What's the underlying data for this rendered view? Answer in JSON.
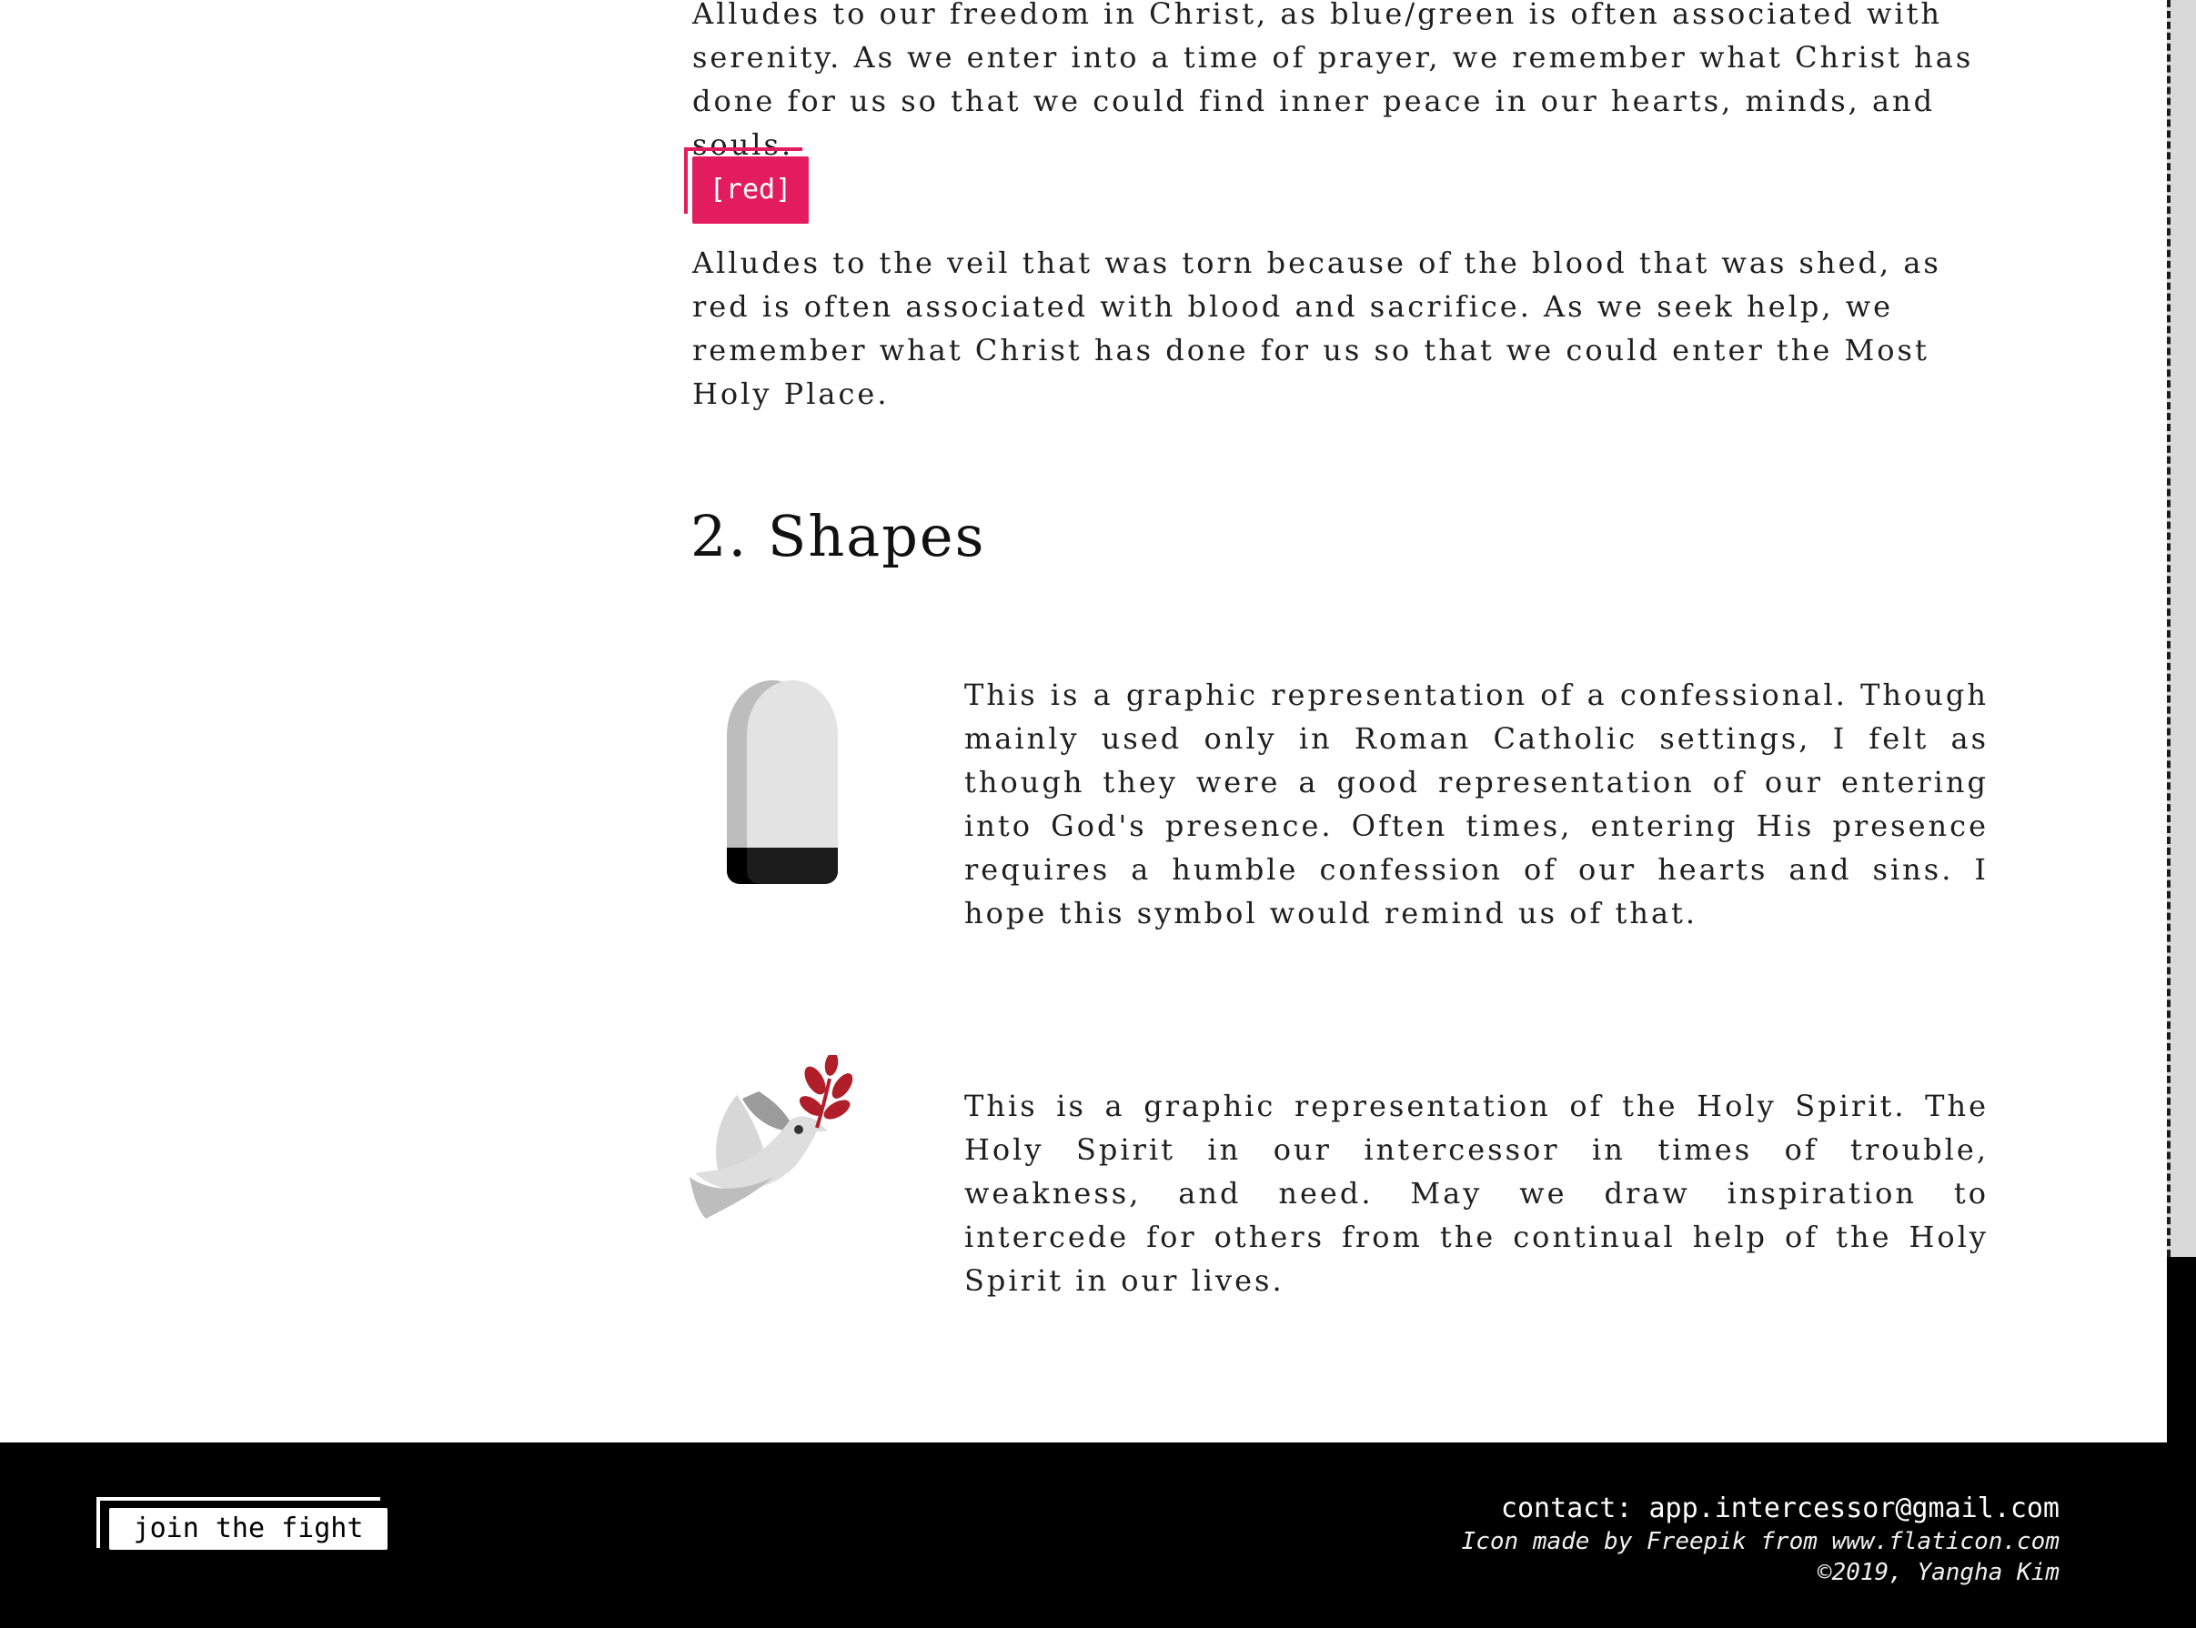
{
  "colors": {
    "accent": "#e31c5f",
    "footer_bg": "#000000",
    "text": "#1f1f1f"
  },
  "colors_section": {
    "blue_green_text": "Alludes to our freedom in Christ, as blue/green is often associated with serenity. As we enter into a time of prayer, we remember what Christ has done for us so that we could find inner peace in our hearts, minds, and souls.",
    "red_badge": "[red]",
    "red_text": "Alludes to the veil that was torn because of the blood that was shed, as red is often associated with blood and sacrifice. As we seek help, we remember what Christ has done for us so that we could enter the Most Holy Place."
  },
  "shapes": {
    "title": "2. Shapes",
    "items": [
      {
        "icon": "confessional-icon",
        "text": "This is a graphic representation of a confessional. Though mainly used only in Roman Catholic settings, I felt as though they were a good representation of our entering into God's presence. Often times, entering His presence requires a humble confession of our hearts and sins. I hope this symbol would remind us of that."
      },
      {
        "icon": "dove-icon",
        "text": "This is a graphic representation of the Holy Spirit. The Holy Spirit in our intercessor in times of trouble, weakness, and need. May we draw inspiration to intercede for others from the continual help of the Holy Spirit in our lives."
      }
    ]
  },
  "footer": {
    "join_label": "join the fight",
    "contact": "contact: app.intercessor@gmail.com",
    "credit": "Icon made by Freepik from www.flaticon.com",
    "copyright": "©2019, Yangha Kim"
  }
}
